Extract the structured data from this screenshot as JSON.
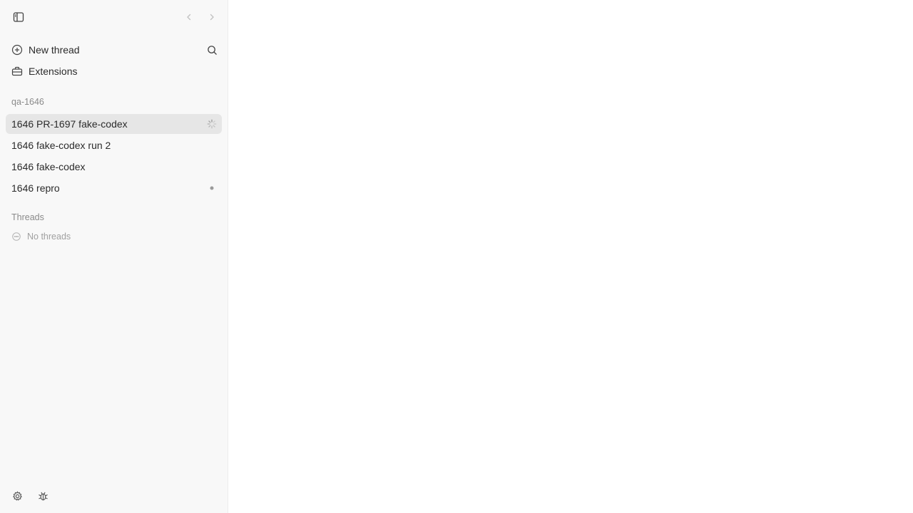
{
  "header": {
    "toggle_icon": "sidebar-toggle-icon",
    "back_icon": "chevron-left-icon",
    "forward_icon": "chevron-right-icon"
  },
  "nav": {
    "new_thread_label": "New thread",
    "new_thread_icon": "plus-circle-icon",
    "search_icon": "search-icon",
    "extensions_label": "Extensions",
    "extensions_icon": "toolbox-icon"
  },
  "project": {
    "label": "qa-1646",
    "threads": [
      {
        "label": "1646 PR-1697 fake-codex",
        "active": true,
        "status": "loading-spinner-icon"
      },
      {
        "label": "1646 fake-codex run 2",
        "active": false,
        "status": ""
      },
      {
        "label": "1646 fake-codex",
        "active": false,
        "status": ""
      },
      {
        "label": "1646 repro",
        "active": false,
        "status": "unread-dot"
      }
    ]
  },
  "threads_section": {
    "label": "Threads",
    "empty_label": "No threads",
    "empty_icon": "chat-bubble-icon"
  },
  "footer": {
    "settings_icon": "gear-icon",
    "debug_icon": "bug-icon"
  },
  "colors": {
    "sidebar_bg": "#f8f8f8",
    "active_row": "#e6e6e6",
    "main_bg": "#ffffff"
  }
}
